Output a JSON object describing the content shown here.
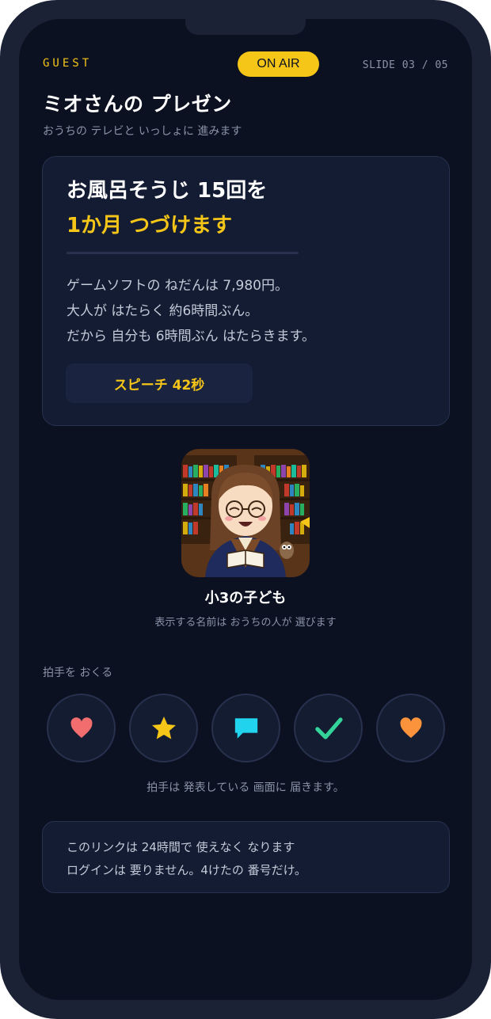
{
  "header": {
    "guest_label": "GUEST",
    "on_air_label": "ON AIR",
    "slide_indicator": "SLIDE 03 / 05",
    "title": "ミオさんの プレゼン",
    "subtitle": "おうちの テレビと いっしょに 進みます"
  },
  "card": {
    "headline_line1": "お風呂そうじ 15回を",
    "headline_line2": "1か月 つづけます",
    "body_lines": [
      "ゲームソフトの ねだんは 7,980円。",
      "大人が はたらく 約6時間ぶん。",
      "だから 自分も 6時間ぶん はたらきます。"
    ],
    "speech_label": "スピーチ 42秒"
  },
  "presenter": {
    "avatar_icon": "presenter-avatar-illustration",
    "name": "小3の子ども",
    "note": "表示する名前は おうちの人が 選びます"
  },
  "applause": {
    "label": "拍手を おくる",
    "buttons": [
      {
        "icon": "heart-icon",
        "color": "#f26d6d"
      },
      {
        "icon": "star-icon",
        "color": "#f5c518"
      },
      {
        "icon": "speech-bubble-icon",
        "color": "#22d3ee"
      },
      {
        "icon": "checkmark-icon",
        "color": "#34d399"
      },
      {
        "icon": "heart-icon",
        "color": "#fb923c"
      }
    ],
    "note": "拍手は 発表している 画面に 届きます。"
  },
  "info": {
    "lines": [
      "このリンクは 24時間で 使えなく なります",
      "ログインは 要りません。4けたの 番号だけ。"
    ]
  },
  "colors": {
    "accent": "#f5c518",
    "background": "#0b1120",
    "card": "#131c33",
    "frame": "#1c2236"
  }
}
